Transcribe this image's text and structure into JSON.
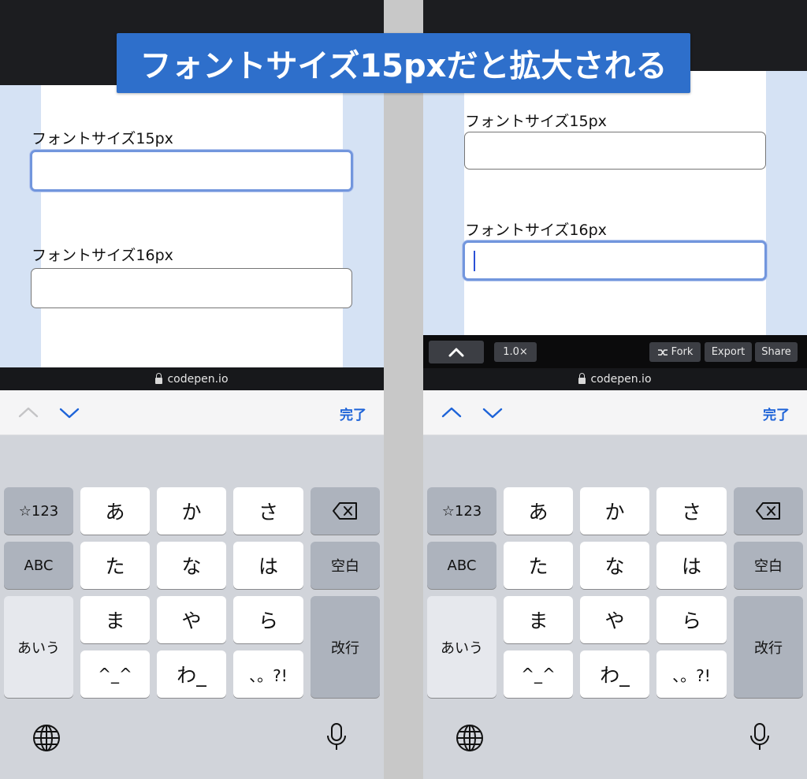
{
  "banner": {
    "title": "フォントサイズ15pxだと拡大される"
  },
  "left": {
    "field15_label": "フォントサイズ15px",
    "field16_label": "フォントサイズ16px",
    "url": "codepen.io",
    "done": "完了"
  },
  "right": {
    "field15_label": "フォントサイズ15px",
    "field16_label": "フォントサイズ16px",
    "codepen": {
      "zoom": "1.0×",
      "fork": "Fork",
      "export": "Export",
      "share": "Share"
    },
    "url": "codepen.io",
    "done": "完了"
  },
  "keyboard": {
    "sym": "☆123",
    "abc": "ABC",
    "aiu": "あいう",
    "space": "空白",
    "enter": "改行",
    "row1": [
      "あ",
      "か",
      "さ"
    ],
    "row2": [
      "た",
      "な",
      "は"
    ],
    "row3": [
      "ま",
      "や",
      "ら"
    ],
    "row4": [
      "^_^",
      "わ_",
      "、。?!"
    ]
  },
  "icons": [
    "backspace-icon",
    "globe-icon",
    "microphone-icon",
    "chevron-up-icon",
    "chevron-down-icon",
    "lock-icon",
    "fork-icon"
  ],
  "colors": {
    "banner": "#2e6fcb",
    "focus_ring": "#7296dd",
    "done_blue": "#1d63d8",
    "preview_side": "#d5e2f4"
  }
}
